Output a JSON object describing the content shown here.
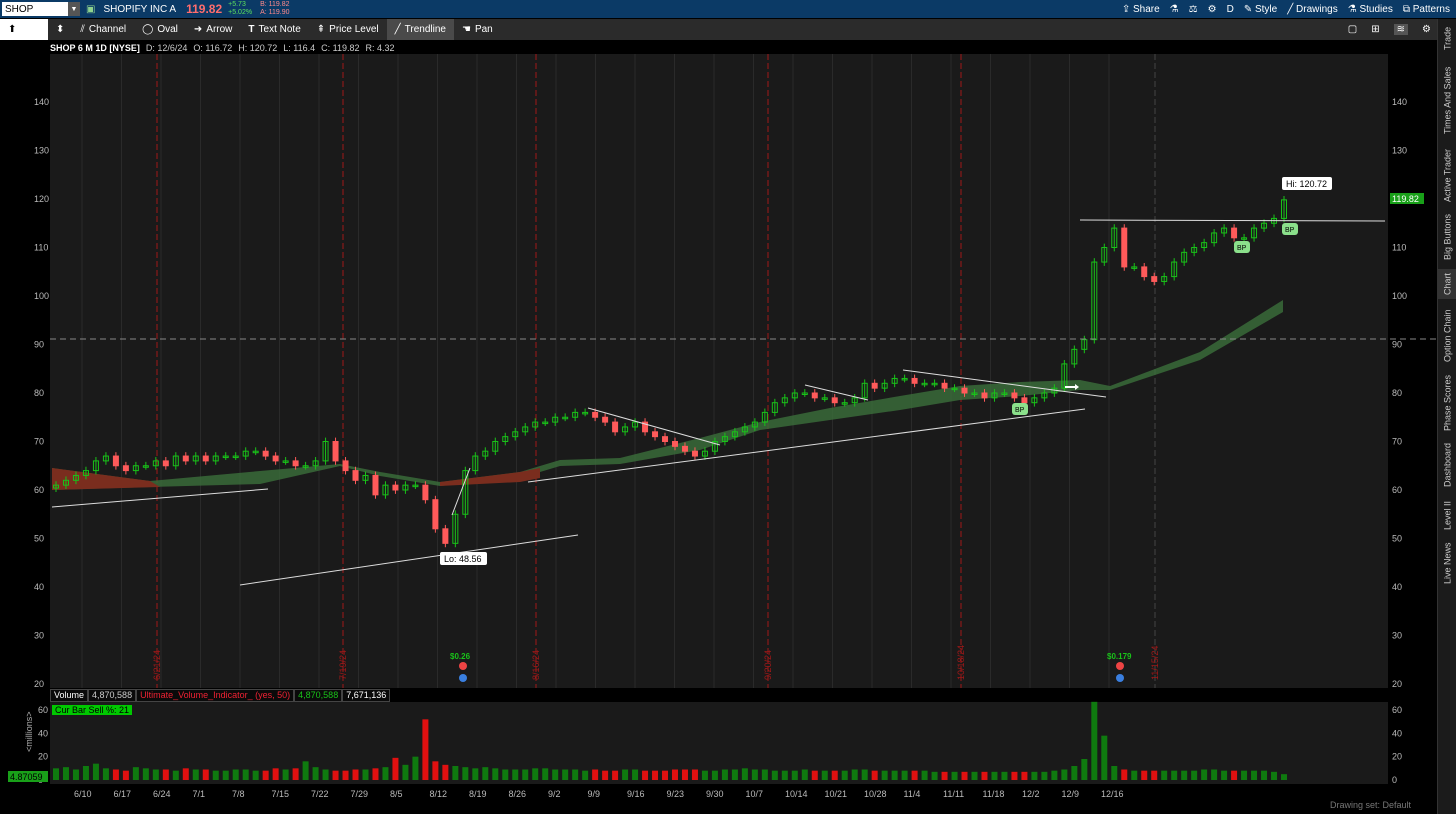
{
  "header": {
    "symbol": "SHOP",
    "company": "SHOPIFY INC A",
    "last": "119.82",
    "change": "+5.73",
    "change_pct": "+5.02%",
    "bid": "B: 119.82",
    "ask": "A: 119.90",
    "right_buttons": [
      "Share",
      "D",
      "Style",
      "Drawings",
      "Studies",
      "Patterns"
    ]
  },
  "toolbar": {
    "tools": [
      "Channel",
      "Oval",
      "Arrow",
      "Text Note",
      "Price Level",
      "Trendline",
      "Pan"
    ],
    "active": "Trendline"
  },
  "side_tabs": [
    "Trade",
    "Times And Sales",
    "Active Trader",
    "Big Buttons",
    "Chart",
    "Option Chain",
    "Phase Scores",
    "Dashboard",
    "Level II",
    "Live News"
  ],
  "info": {
    "title": "SHOP 6 M 1D [NYSE]",
    "date": "D: 12/6/24",
    "open": "O: 116.72",
    "high": "H: 120.72",
    "low": "L: 116.4",
    "close": "C: 119.82",
    "range": "R: 4.32"
  },
  "annotations": {
    "hi": "Hi: 120.72",
    "lo": "Lo: 48.56",
    "bp": "BP",
    "earn1": "$0.26",
    "earn2": "$0.179",
    "last_price": "119.82",
    "vol_last": "4.87059"
  },
  "volume_header": {
    "label": "Volume",
    "value": "4,870,588",
    "indicator": "Ultimate_Volume_Indicator_ (yes, 50)",
    "ind_value": "4,870,588",
    "ind_value2": "7,671,136"
  },
  "sell_badge": "Cur Bar Sell %: 21",
  "status": "Drawing set: Default",
  "volume_axis_label": "<millions>",
  "colors": {
    "up": "#19c219",
    "down": "#ff5a5a",
    "ma_up": "#3a6b3a",
    "ma_down": "#7a2d1e",
    "bg": "#1a1a1a"
  },
  "chart_data": {
    "type": "candlestick",
    "y_ticks": [
      20,
      30,
      40,
      50,
      60,
      70,
      80,
      90,
      100,
      110,
      120,
      130,
      140
    ],
    "x_labels": [
      "6/10",
      "6/17",
      "6/24",
      "7/1",
      "7/8",
      "7/15",
      "7/22",
      "7/29",
      "8/5",
      "8/12",
      "8/19",
      "8/26",
      "9/2",
      "9/9",
      "9/16",
      "9/23",
      "9/30",
      "10/7",
      "10/14",
      "10/21",
      "10/28",
      "11/4",
      "11/11",
      "11/18",
      "12/2",
      "12/9",
      "12/16"
    ],
    "event_lines": [
      "6/21/24",
      "7/19/24",
      "8/16/24",
      "9/20/24",
      "10/18/24",
      "11/15/24"
    ],
    "vol_ticks": [
      0,
      20,
      40,
      60
    ],
    "closes": [
      61,
      62,
      63,
      64,
      66,
      67,
      65,
      64,
      65,
      65,
      66,
      65,
      67,
      66,
      67,
      66,
      67,
      67,
      67,
      68,
      68,
      67,
      66,
      66,
      65,
      65,
      66,
      70,
      66,
      64,
      62,
      63,
      59,
      61,
      60,
      61,
      61,
      58,
      52,
      49,
      55,
      64,
      67,
      68,
      70,
      71,
      72,
      73,
      74,
      74,
      75,
      75,
      76,
      76,
      75,
      74,
      72,
      73,
      74,
      72,
      71,
      70,
      69,
      68,
      67,
      68,
      70,
      71,
      72,
      73,
      74,
      76,
      78,
      79,
      80,
      80,
      79,
      79,
      78,
      78,
      79,
      82,
      81,
      82,
      83,
      83,
      82,
      82,
      82,
      81,
      81,
      80,
      80,
      79,
      80,
      80,
      79,
      78,
      79,
      80,
      81,
      86,
      89,
      91,
      107,
      110,
      114,
      106,
      106,
      104,
      103,
      104,
      107,
      109,
      110,
      111,
      113,
      114,
      112,
      112,
      114,
      115,
      116,
      119.82
    ],
    "volumes": [
      10,
      11,
      9,
      12,
      14,
      10,
      9,
      8,
      11,
      10,
      9,
      9,
      8,
      10,
      9,
      9,
      8,
      8,
      9,
      9,
      8,
      8,
      10,
      9,
      10,
      16,
      11,
      9,
      8,
      8,
      9,
      9,
      10,
      11,
      19,
      13,
      20,
      52,
      16,
      13,
      12,
      11,
      10,
      11,
      10,
      9,
      9,
      9,
      10,
      10,
      9,
      9,
      9,
      8,
      9,
      8,
      8,
      9,
      9,
      8,
      8,
      8,
      9,
      9,
      9,
      8,
      8,
      9,
      9,
      10,
      9,
      9,
      8,
      8,
      8,
      9,
      8,
      8,
      8,
      8,
      9,
      9,
      8,
      8,
      8,
      8,
      8,
      8,
      7,
      7,
      7,
      7,
      7,
      7,
      7,
      7,
      7,
      7,
      7,
      7,
      8,
      9,
      12,
      18,
      67,
      38,
      12,
      9,
      8,
      8,
      8,
      8,
      8,
      8,
      8,
      9,
      9,
      8,
      8,
      8,
      8,
      8,
      7,
      5
    ]
  }
}
